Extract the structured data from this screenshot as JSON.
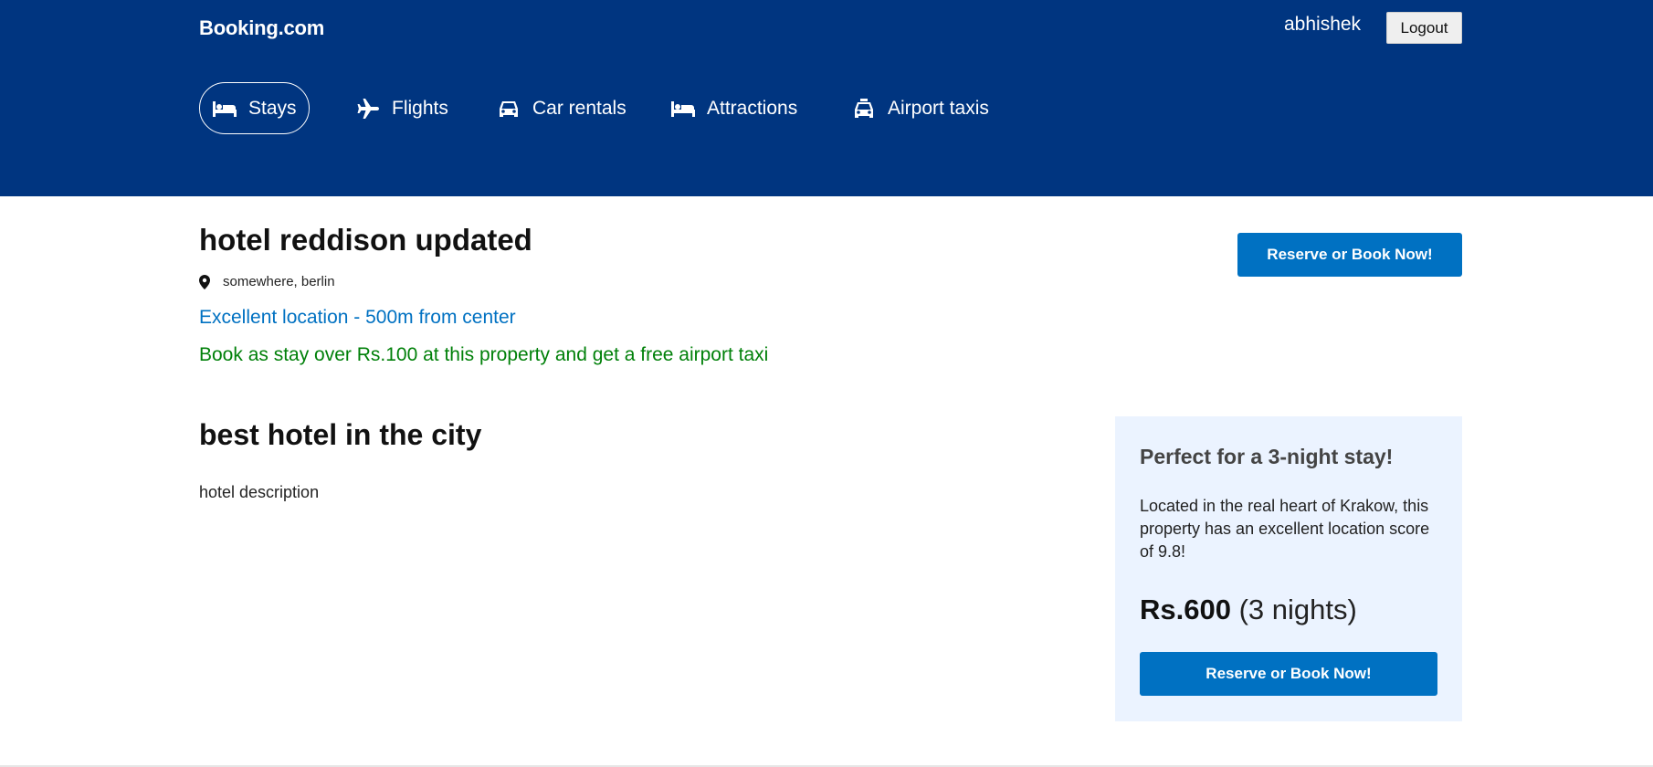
{
  "header": {
    "logo": "Booking.com",
    "username": "abhishek",
    "logout_label": "Logout",
    "background_color": "#003580"
  },
  "nav": {
    "items": [
      {
        "label": "Stays",
        "icon": "bed-icon",
        "active": true
      },
      {
        "label": "Flights",
        "icon": "plane-icon",
        "active": false
      },
      {
        "label": "Car rentals",
        "icon": "car-icon",
        "active": false
      },
      {
        "label": "Attractions",
        "icon": "bed-icon",
        "active": false
      },
      {
        "label": "Airport taxis",
        "icon": "taxi-icon",
        "active": false
      }
    ]
  },
  "hotel": {
    "name": "hotel reddison updated",
    "address": "somewhere, berlin",
    "distance_text": "Excellent location - 500m from center",
    "offer_text": "Book as stay over Rs.100 at this property and get a free airport taxi",
    "reserve_label": "Reserve or Book Now!",
    "section_title": "best hotel in the city",
    "description": "hotel description"
  },
  "side_card": {
    "title": "Perfect for a 3-night stay!",
    "text": "Located in the real heart of Krakow, this property has an excellent location score of 9.8!",
    "price": "Rs.600",
    "nights": "(3 nights)",
    "reserve_label": "Reserve or Book Now!",
    "background_color": "#ebf3ff"
  },
  "colors": {
    "primary_button": "#0071c2",
    "distance_text": "#0071c2",
    "offer_text": "#008009"
  }
}
